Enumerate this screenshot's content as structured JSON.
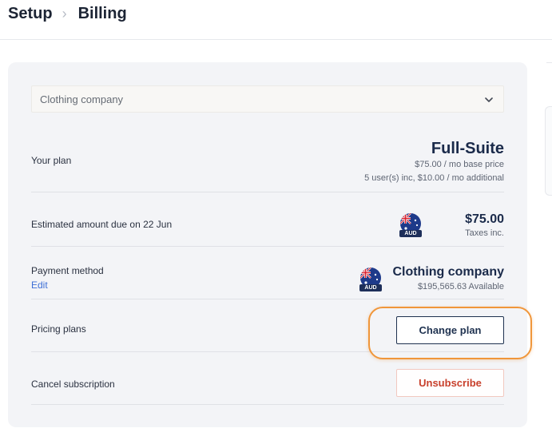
{
  "breadcrumb": {
    "items": [
      "Setup",
      "Billing"
    ]
  },
  "company_select": {
    "value": "Clothing company"
  },
  "plan": {
    "label": "Your plan",
    "name": "Full-Suite",
    "base_price": "$75.00 / mo base price",
    "users_info": "5 user(s) inc, $10.00 / mo additional"
  },
  "estimate": {
    "label": "Estimated amount due on 22 Jun",
    "currency": "AUD",
    "amount": "$75.00",
    "taxes": "Taxes inc."
  },
  "payment": {
    "label": "Payment method",
    "edit_label": "Edit",
    "currency": "AUD",
    "name": "Clothing company",
    "available": "$195,565.63 Available"
  },
  "pricing": {
    "label": "Pricing plans",
    "button_label": "Change plan"
  },
  "cancel": {
    "label": "Cancel subscription",
    "button_label": "Unsubscribe"
  },
  "colors": {
    "accent_navy": "#1f3250",
    "danger": "#c8402c",
    "highlight": "#f0963a",
    "link": "#3d6fd6"
  }
}
